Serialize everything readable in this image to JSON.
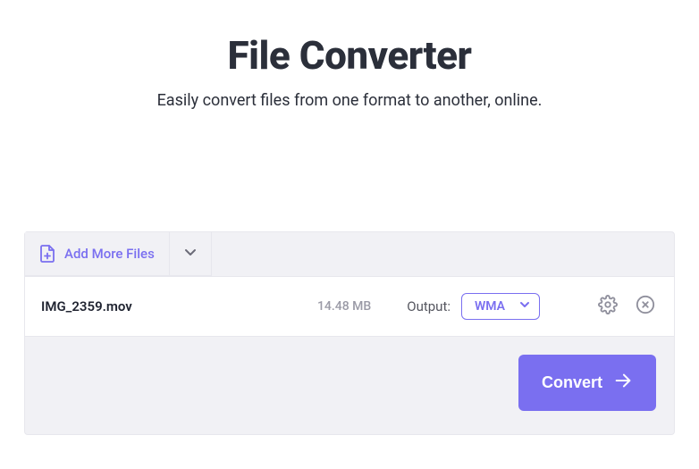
{
  "hero": {
    "title": "File Converter",
    "subtitle": "Easily convert files from one format to another, online."
  },
  "toolbar": {
    "add_more_label": "Add More Files"
  },
  "file": {
    "name": "IMG_2359.mov",
    "size": "14.48 MB",
    "output_label": "Output:",
    "format": "WMA"
  },
  "actions": {
    "convert_label": "Convert"
  },
  "colors": {
    "accent": "#7a6ff0"
  }
}
